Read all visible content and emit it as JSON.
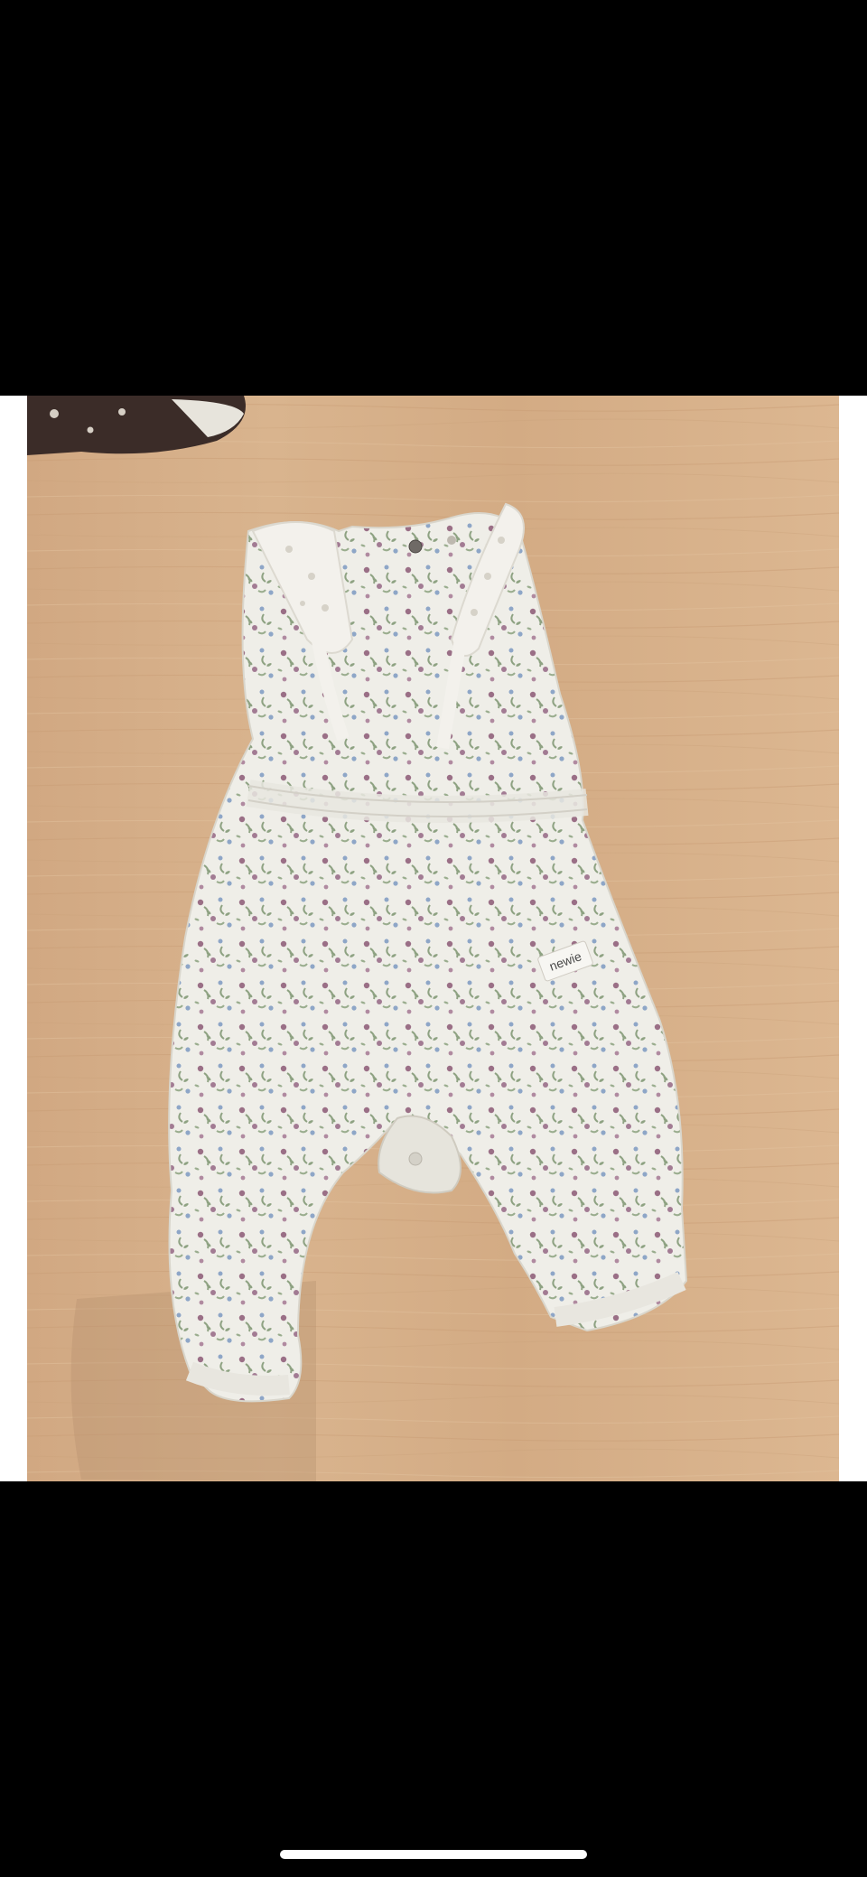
{
  "photo": {
    "subject": "floral-romper-icon",
    "label_text": "newie"
  },
  "colors": {
    "background": "#000000",
    "frame": "#ffffff",
    "wood": "#d7b08a",
    "fabric": "#efeee8",
    "flower_mauve": "#9a6f86",
    "flower_blue": "#8ea6c7",
    "leaf_green": "#8ea282"
  }
}
